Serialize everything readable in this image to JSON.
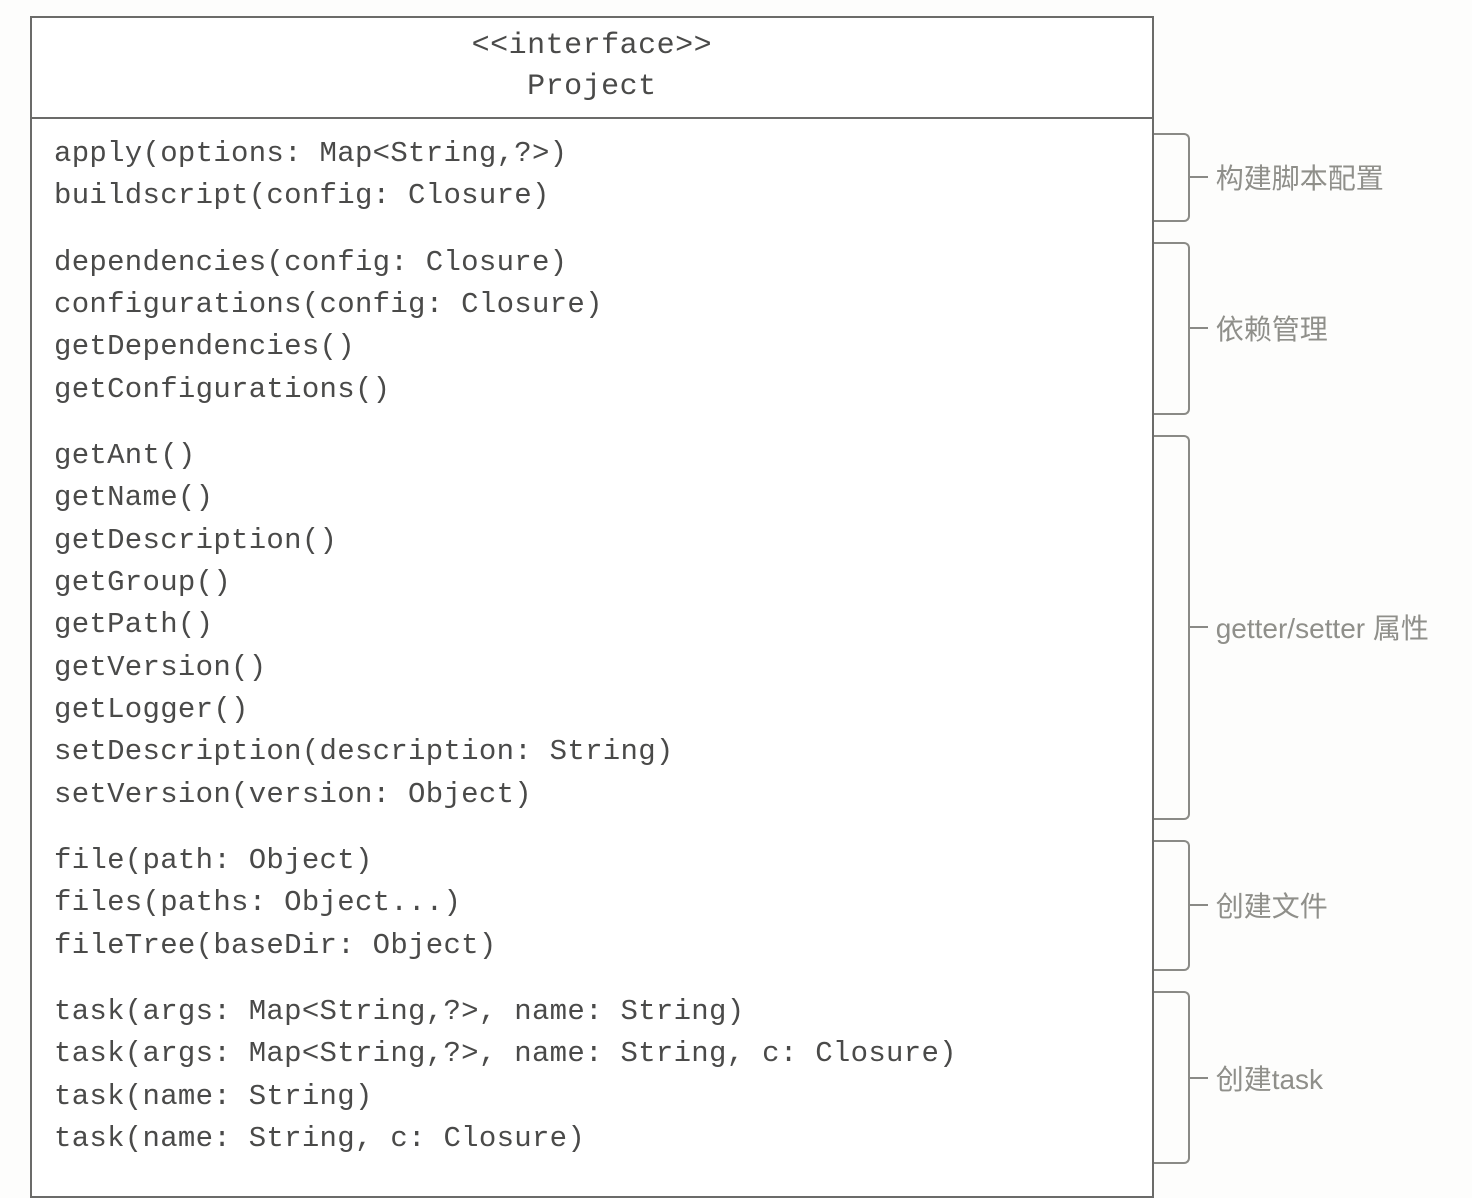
{
  "uml": {
    "stereotype": "<<interface>>",
    "name": "Project",
    "groups": [
      {
        "id": "g1",
        "label": "构建脚本配置",
        "methods": [
          "apply(options: Map<String,?>)",
          "buildscript(config: Closure)"
        ]
      },
      {
        "id": "g2",
        "label": "依赖管理",
        "methods": [
          "dependencies(config: Closure)",
          "configurations(config: Closure)",
          "getDependencies()",
          "getConfigurations()"
        ]
      },
      {
        "id": "g3",
        "label": "getter/setter 属性",
        "methods": [
          "getAnt()",
          "getName()",
          "getDescription()",
          "getGroup()",
          "getPath()",
          "getVersion()",
          "getLogger()",
          "setDescription(description: String)",
          "setVersion(version: Object)"
        ]
      },
      {
        "id": "g4",
        "label": "创建文件",
        "methods": [
          "file(path: Object)",
          "files(paths: Object...)",
          "fileTree(baseDir: Object)"
        ]
      },
      {
        "id": "g5",
        "label": "创建task",
        "methods": [
          "task(args: Map<String,?>, name: String)",
          "task(args: Map<String,?>, name: String, c: Closure)",
          "task(name: String)",
          "task(name: String, c: Closure)"
        ]
      }
    ]
  }
}
